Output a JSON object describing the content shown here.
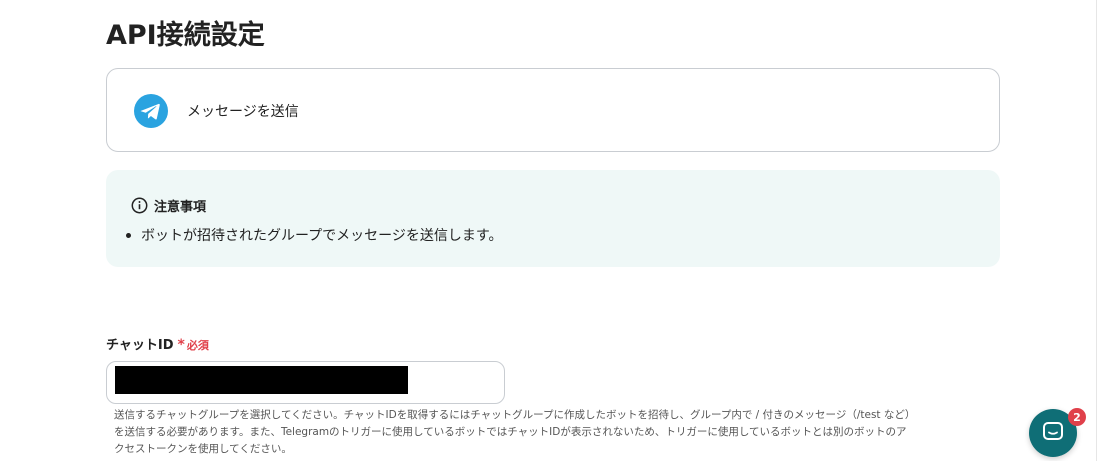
{
  "page": {
    "title": "API接続設定"
  },
  "action": {
    "label": "メッセージを送信",
    "icon": "telegram-icon",
    "accent": "#2aa3e0"
  },
  "notice": {
    "title": "注意事項",
    "items": [
      "ボットが招待されたグループでメッセージを送信します。"
    ],
    "background": "#eff8f7"
  },
  "field": {
    "label": "チャットID",
    "required_mark": "*",
    "required_text": "必須",
    "value_redacted": true,
    "help": "送信するチャットグループを選択してください。チャットIDを取得するにはチャットグループに作成したボットを招待し、グループ内で / 付きのメッセージ（/test など）を送信する必要があります。また、Telegramのトリガーに使用しているボットではチャットIDが表示されないため、トリガーに使用しているボットとは別のボットのアクセストークンを使用してください。"
  },
  "chat_widget": {
    "badge_count": "2",
    "color": "#0f6e76"
  }
}
